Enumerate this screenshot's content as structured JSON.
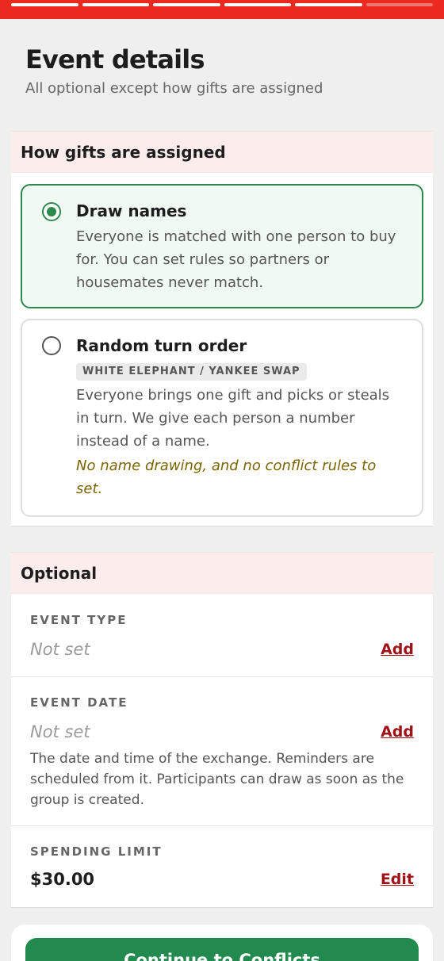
{
  "progress": {
    "total_steps": 6,
    "completed_steps": 5
  },
  "header": {
    "title": "Event details",
    "subtitle": "All optional except how gifts are assigned"
  },
  "assignment": {
    "heading": "How gifts are assigned",
    "options": [
      {
        "title": "Draw names",
        "description": "Everyone is matched with one person to buy for. You can set rules so partners or housemates never match.",
        "selected": true
      },
      {
        "title": "Random turn order",
        "tag": "WHITE ELEPHANT / YANKEE SWAP",
        "description": "Everyone brings one gift and picks or steals in turn. We give each person a number instead of a name.",
        "note": "No name drawing, and no conflict rules to set.",
        "selected": false
      }
    ]
  },
  "optional": {
    "heading": "Optional",
    "event_type": {
      "label": "EVENT TYPE",
      "value": "Not set",
      "action": "Add"
    },
    "event_date": {
      "label": "EVENT DATE",
      "value": "Not set",
      "action": "Add",
      "help": "The date and time of the exchange. Reminders are scheduled from it. Participants can draw as soon as the group is created."
    },
    "spending_limit": {
      "label": "SPENDING LIMIT",
      "value": "$30.00",
      "action": "Edit"
    }
  },
  "footer": {
    "continue_label": "Continue to Conflicts"
  },
  "colors": {
    "accent_red": "#ea2a1f",
    "accent_green": "#238a4f",
    "link": "#a01218"
  }
}
